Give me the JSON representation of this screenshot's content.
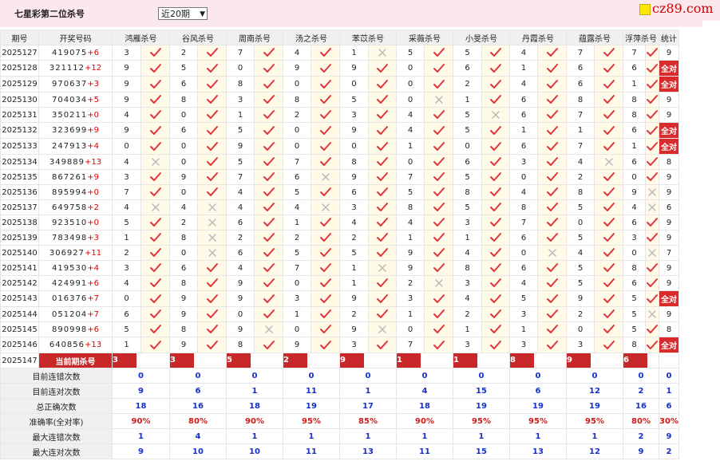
{
  "header": {
    "title": "七星彩第二位杀号",
    "period_select_value": "近20期",
    "logo_text": "cz89.com"
  },
  "columns": {
    "period": "期号",
    "draw": "开奖号码",
    "experts": [
      "鸿雁杀号",
      "谷风杀号",
      "周南杀号",
      "汤之杀号",
      "苯苡杀号",
      "采薇杀号",
      "小旻杀号",
      "丹霞杀号",
      "蕴露杀号",
      "浮萍杀号"
    ],
    "stats": "统计"
  },
  "rows": [
    {
      "period": "2025127",
      "draw": "419075",
      "sum": "+6",
      "picks": [
        "3",
        "2",
        "7",
        "4",
        "1",
        "5",
        "5",
        "4",
        "7",
        "7"
      ],
      "marks": [
        "ok",
        "ok",
        "ok",
        "ok",
        "x",
        "ok",
        "ok",
        "ok",
        "ok",
        "ok"
      ],
      "stat": "9"
    },
    {
      "period": "2025128",
      "draw": "321112",
      "sum": "+12",
      "picks": [
        "9",
        "5",
        "0",
        "9",
        "9",
        "0",
        "6",
        "1",
        "6",
        "6"
      ],
      "marks": [
        "ok",
        "ok",
        "ok",
        "ok",
        "ok",
        "ok",
        "ok",
        "ok",
        "ok",
        "ok"
      ],
      "stat": "全对"
    },
    {
      "period": "2025129",
      "draw": "970637",
      "sum": "+3",
      "picks": [
        "9",
        "6",
        "8",
        "0",
        "0",
        "0",
        "2",
        "4",
        "6",
        "1"
      ],
      "marks": [
        "ok",
        "ok",
        "ok",
        "ok",
        "ok",
        "ok",
        "ok",
        "ok",
        "ok",
        "ok"
      ],
      "stat": "全对"
    },
    {
      "period": "2025130",
      "draw": "704034",
      "sum": "+5",
      "picks": [
        "9",
        "8",
        "3",
        "8",
        "5",
        "0",
        "1",
        "6",
        "8",
        "8"
      ],
      "marks": [
        "ok",
        "ok",
        "ok",
        "ok",
        "ok",
        "x",
        "ok",
        "ok",
        "ok",
        "ok"
      ],
      "stat": "9"
    },
    {
      "period": "2025131",
      "draw": "350211",
      "sum": "+0",
      "picks": [
        "4",
        "0",
        "1",
        "2",
        "3",
        "4",
        "5",
        "6",
        "7",
        "8"
      ],
      "marks": [
        "ok",
        "ok",
        "ok",
        "ok",
        "ok",
        "ok",
        "x",
        "ok",
        "ok",
        "ok"
      ],
      "stat": "9"
    },
    {
      "period": "2025132",
      "draw": "323699",
      "sum": "+9",
      "picks": [
        "9",
        "6",
        "5",
        "0",
        "9",
        "4",
        "5",
        "1",
        "1",
        "6"
      ],
      "marks": [
        "ok",
        "ok",
        "ok",
        "ok",
        "ok",
        "ok",
        "ok",
        "ok",
        "ok",
        "ok"
      ],
      "stat": "全对"
    },
    {
      "period": "2025133",
      "draw": "247913",
      "sum": "+4",
      "picks": [
        "0",
        "0",
        "9",
        "0",
        "0",
        "1",
        "0",
        "6",
        "7",
        "1"
      ],
      "marks": [
        "ok",
        "ok",
        "ok",
        "ok",
        "ok",
        "ok",
        "ok",
        "ok",
        "ok",
        "ok"
      ],
      "stat": "全对"
    },
    {
      "period": "2025134",
      "draw": "349889",
      "sum": "+13",
      "picks": [
        "4",
        "0",
        "5",
        "7",
        "8",
        "0",
        "6",
        "3",
        "4",
        "6"
      ],
      "marks": [
        "x",
        "ok",
        "ok",
        "ok",
        "ok",
        "ok",
        "ok",
        "ok",
        "x",
        "ok"
      ],
      "stat": "8"
    },
    {
      "period": "2025135",
      "draw": "867261",
      "sum": "+9",
      "picks": [
        "3",
        "9",
        "7",
        "6",
        "9",
        "7",
        "5",
        "0",
        "2",
        "0"
      ],
      "marks": [
        "ok",
        "ok",
        "ok",
        "x",
        "ok",
        "ok",
        "ok",
        "ok",
        "ok",
        "ok"
      ],
      "stat": "9"
    },
    {
      "period": "2025136",
      "draw": "895994",
      "sum": "+0",
      "picks": [
        "7",
        "0",
        "4",
        "5",
        "6",
        "5",
        "8",
        "4",
        "8",
        "9"
      ],
      "marks": [
        "ok",
        "ok",
        "ok",
        "ok",
        "ok",
        "ok",
        "ok",
        "ok",
        "ok",
        "x"
      ],
      "stat": "9"
    },
    {
      "period": "2025137",
      "draw": "649758",
      "sum": "+2",
      "picks": [
        "4",
        "4",
        "4",
        "4",
        "3",
        "8",
        "5",
        "8",
        "5",
        "4"
      ],
      "marks": [
        "x",
        "x",
        "ok",
        "x",
        "ok",
        "ok",
        "ok",
        "ok",
        "ok",
        "x"
      ],
      "stat": "6"
    },
    {
      "period": "2025138",
      "draw": "923510",
      "sum": "+0",
      "picks": [
        "5",
        "2",
        "6",
        "1",
        "4",
        "4",
        "3",
        "7",
        "0",
        "6"
      ],
      "marks": [
        "ok",
        "x",
        "ok",
        "ok",
        "ok",
        "ok",
        "ok",
        "ok",
        "ok",
        "ok"
      ],
      "stat": "9"
    },
    {
      "period": "2025139",
      "draw": "783498",
      "sum": "+3",
      "picks": [
        "1",
        "8",
        "2",
        "2",
        "2",
        "1",
        "1",
        "6",
        "5",
        "3"
      ],
      "marks": [
        "ok",
        "x",
        "ok",
        "ok",
        "ok",
        "ok",
        "ok",
        "ok",
        "ok",
        "ok"
      ],
      "stat": "9"
    },
    {
      "period": "2025140",
      "draw": "306927",
      "sum": "+11",
      "picks": [
        "2",
        "0",
        "6",
        "5",
        "5",
        "9",
        "4",
        "0",
        "4",
        "0"
      ],
      "marks": [
        "ok",
        "x",
        "ok",
        "ok",
        "ok",
        "ok",
        "ok",
        "x",
        "ok",
        "x"
      ],
      "stat": "7"
    },
    {
      "period": "2025141",
      "draw": "419530",
      "sum": "+4",
      "picks": [
        "3",
        "6",
        "4",
        "7",
        "1",
        "9",
        "8",
        "6",
        "5",
        "8"
      ],
      "marks": [
        "ok",
        "ok",
        "ok",
        "ok",
        "x",
        "ok",
        "ok",
        "ok",
        "ok",
        "ok"
      ],
      "stat": "9"
    },
    {
      "period": "2025142",
      "draw": "424991",
      "sum": "+6",
      "picks": [
        "4",
        "8",
        "9",
        "0",
        "1",
        "2",
        "3",
        "4",
        "5",
        "6"
      ],
      "marks": [
        "ok",
        "ok",
        "ok",
        "ok",
        "ok",
        "x",
        "ok",
        "ok",
        "ok",
        "ok"
      ],
      "stat": "9"
    },
    {
      "period": "2025143",
      "draw": "016376",
      "sum": "+7",
      "picks": [
        "0",
        "9",
        "9",
        "3",
        "9",
        "3",
        "4",
        "5",
        "9",
        "5"
      ],
      "marks": [
        "ok",
        "ok",
        "ok",
        "ok",
        "ok",
        "ok",
        "ok",
        "ok",
        "ok",
        "ok"
      ],
      "stat": "全对"
    },
    {
      "period": "2025144",
      "draw": "051204",
      "sum": "+7",
      "picks": [
        "6",
        "9",
        "0",
        "1",
        "2",
        "1",
        "2",
        "3",
        "2",
        "5"
      ],
      "marks": [
        "ok",
        "ok",
        "ok",
        "ok",
        "ok",
        "ok",
        "ok",
        "ok",
        "ok",
        "x"
      ],
      "stat": "9"
    },
    {
      "period": "2025145",
      "draw": "890998",
      "sum": "+6",
      "picks": [
        "5",
        "8",
        "9",
        "0",
        "9",
        "0",
        "1",
        "1",
        "0",
        "5"
      ],
      "marks": [
        "ok",
        "ok",
        "x",
        "ok",
        "x",
        "ok",
        "ok",
        "ok",
        "ok",
        "ok"
      ],
      "stat": "8"
    },
    {
      "period": "2025146",
      "draw": "640856",
      "sum": "+13",
      "picks": [
        "1",
        "9",
        "8",
        "9",
        "3",
        "7",
        "3",
        "3",
        "3",
        "8"
      ],
      "marks": [
        "ok",
        "ok",
        "ok",
        "ok",
        "ok",
        "ok",
        "ok",
        "ok",
        "ok",
        "ok"
      ],
      "stat": "全对"
    }
  ],
  "current": {
    "period": "2025147",
    "label": "当前期杀号",
    "picks": [
      "3",
      "3",
      "5",
      "2",
      "9",
      "1",
      "1",
      "8",
      "9",
      "6"
    ]
  },
  "summary": [
    {
      "label": "目前连错次数",
      "values": [
        "0",
        "0",
        "0",
        "0",
        "0",
        "0",
        "0",
        "0",
        "0",
        "0"
      ],
      "stat": "0",
      "color": "blue"
    },
    {
      "label": "目前连对次数",
      "values": [
        "9",
        "6",
        "1",
        "11",
        "1",
        "4",
        "15",
        "6",
        "12",
        "2"
      ],
      "stat": "1",
      "color": "blue"
    },
    {
      "label": "总正确次数",
      "values": [
        "18",
        "16",
        "18",
        "19",
        "17",
        "18",
        "19",
        "19",
        "19",
        "16"
      ],
      "stat": "6",
      "color": "blue"
    },
    {
      "label": "准确率(全对率)",
      "values": [
        "90%",
        "80%",
        "90%",
        "95%",
        "85%",
        "90%",
        "95%",
        "95%",
        "95%",
        "80%"
      ],
      "stat": "30%",
      "color": "red"
    },
    {
      "label": "最大连错次数",
      "values": [
        "1",
        "4",
        "1",
        "1",
        "1",
        "1",
        "1",
        "1",
        "1",
        "2"
      ],
      "stat": "9",
      "color": "blue"
    },
    {
      "label": "最大连对次数",
      "values": [
        "9",
        "10",
        "10",
        "11",
        "13",
        "11",
        "15",
        "13",
        "12",
        "9"
      ],
      "stat": "2",
      "color": "blue"
    }
  ]
}
